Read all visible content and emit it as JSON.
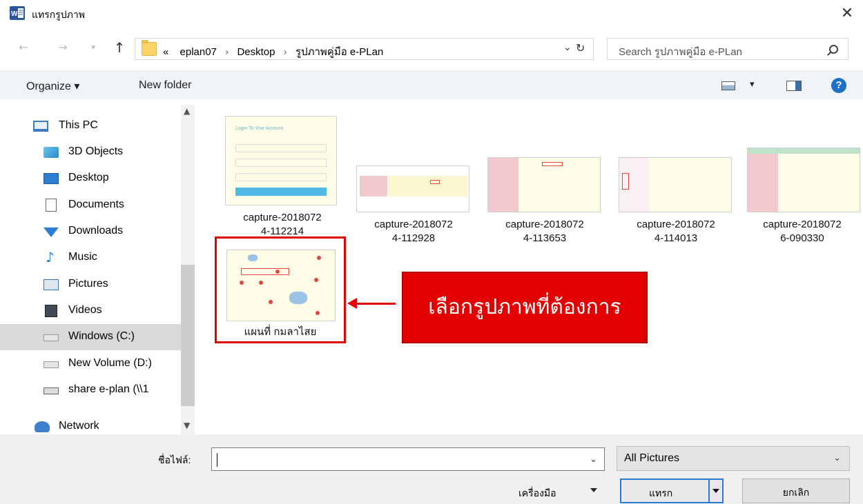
{
  "window": {
    "title": "แทรกรูปภาพ",
    "app_icon": "word-icon"
  },
  "navigation": {
    "back_icon": "←",
    "forward_icon": "→",
    "recent_icon": "⌄",
    "up_icon": "↑",
    "breadcrumb": [
      "eplan07",
      "Desktop",
      "รูปภาพคู่มือ e-PLan"
    ],
    "overflow": "«",
    "search_placeholder": "Search รูปภาพคู่มือ e-PLan"
  },
  "toolbar": {
    "organize": "Organize ▾",
    "new_folder": "New folder",
    "help": "?"
  },
  "sidebar": {
    "items": [
      {
        "label": "This PC",
        "icon": "computer-icon"
      },
      {
        "label": "3D Objects",
        "icon": "3d-objects-icon"
      },
      {
        "label": "Desktop",
        "icon": "desktop-icon"
      },
      {
        "label": "Documents",
        "icon": "documents-icon"
      },
      {
        "label": "Downloads",
        "icon": "downloads-icon"
      },
      {
        "label": "Music",
        "icon": "music-icon"
      },
      {
        "label": "Pictures",
        "icon": "pictures-icon"
      },
      {
        "label": "Videos",
        "icon": "videos-icon"
      },
      {
        "label": "Windows (C:)",
        "icon": "drive-icon",
        "selected": true
      },
      {
        "label": "New Volume (D:)",
        "icon": "drive-icon"
      },
      {
        "label": "share e-plan (\\\\1",
        "icon": "network-drive-icon"
      },
      {
        "label": "Network",
        "icon": "network-icon"
      }
    ]
  },
  "files": [
    {
      "name": "capture-20180724-112214",
      "line1": "capture-2018072",
      "line2": "4-112214"
    },
    {
      "name": "capture-20180724-112928",
      "line1": "capture-2018072",
      "line2": "4-112928"
    },
    {
      "name": "capture-20180724-113653",
      "line1": "capture-2018072",
      "line2": "4-113653"
    },
    {
      "name": "capture-20180724-114013",
      "line1": "capture-2018072",
      "line2": "4-114013"
    },
    {
      "name": "capture-20180726-090330",
      "line1": "capture-2018072",
      "line2": "6-090330"
    },
    {
      "name": "แผนที่ กมลาไสย",
      "line1": "แผนที่ กมลาไสย",
      "line2": ""
    }
  ],
  "thumbnail_text": {
    "login_title": "Login To Your Account"
  },
  "annotation": {
    "text": "เลือกรูปภาพที่ต้องการ",
    "color": "#e30000"
  },
  "bottom": {
    "filename_label": "ชื่อไฟล์:",
    "filename_value": "",
    "filetype": "All Pictures",
    "tools_label": "เครื่องมือ",
    "insert_label": "แทรก",
    "cancel_label": "ยกเลิก"
  },
  "colors": {
    "accent": "#2b78d6",
    "selection": "#d9d9d9",
    "toolbar_bg": "#f0f4f9"
  }
}
